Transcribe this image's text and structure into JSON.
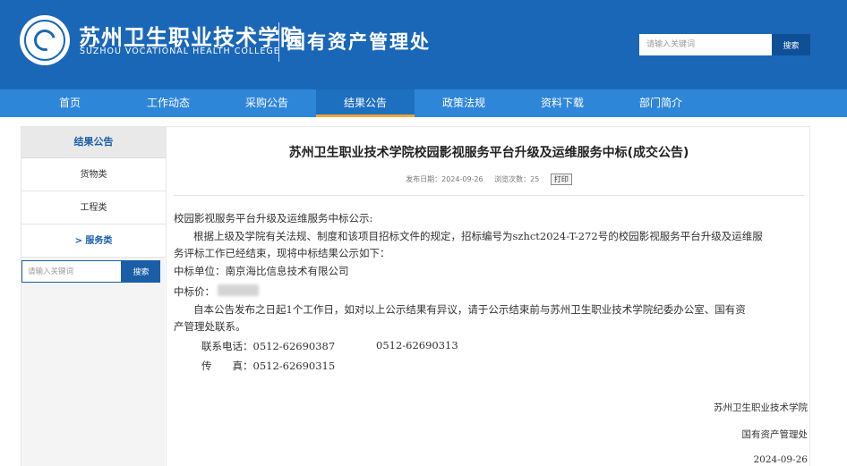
{
  "header": {
    "school_cn": "苏州卫生职业技术学院",
    "school_en": "SUZHOU VOCATIONAL HEALTH COLLEGE",
    "dept": "国有资产管理处",
    "search_placeholder": "请输入关键词",
    "search_label": "搜索",
    "brand_color": "#1a67b8"
  },
  "nav": {
    "items": [
      "首页",
      "工作动态",
      "采购公告",
      "结果公告",
      "政策法规",
      "资料下载",
      "部门简介"
    ],
    "active": "结果公告",
    "active_underline_color": "#f3a63a"
  },
  "sidebar": {
    "title": "结果公告",
    "items": [
      "货物类",
      "工程类",
      "> 服务类"
    ],
    "active": "> 服务类",
    "search_placeholder": "请输入关键词",
    "search_label": "搜索"
  },
  "article": {
    "title": "苏州卫生职业技术学院校园影视服务平台升级及运维服务中标(成交公告)",
    "publish_date": "发布日期：2024-09-26",
    "views": "浏览次数：25",
    "print_label": "打印",
    "p1": "校园影视服务平台升级及运维服务中标公示:",
    "p2_line1": "根据上级及学院有关法规、制度和该项目招标文件的规定，招标编号为szhct2024-T-272号的校园影视服务平台升级及运维服",
    "p2_line2": "务评标工作已经结束，现将中标结果公示如下：",
    "winner": "中标单位：南京海比信息技术有限公司",
    "price_label": "中标价：",
    "p3_line1": "自本公告发布之日起1个工作日，如对以上公示结果有异议，请于公示结束前与苏州卫生职业技术学院纪委办公室、国有资",
    "p3_line2": "产管理处联系。",
    "phone_label": "联系电话：0512-62690387",
    "phone2": "0512-62690313",
    "fax_label": "传　　真：0512-62690315",
    "sign1": "苏州卫生职业技术学院",
    "sign2": "国有资产管理处",
    "sign_date": "2024-09-26"
  }
}
